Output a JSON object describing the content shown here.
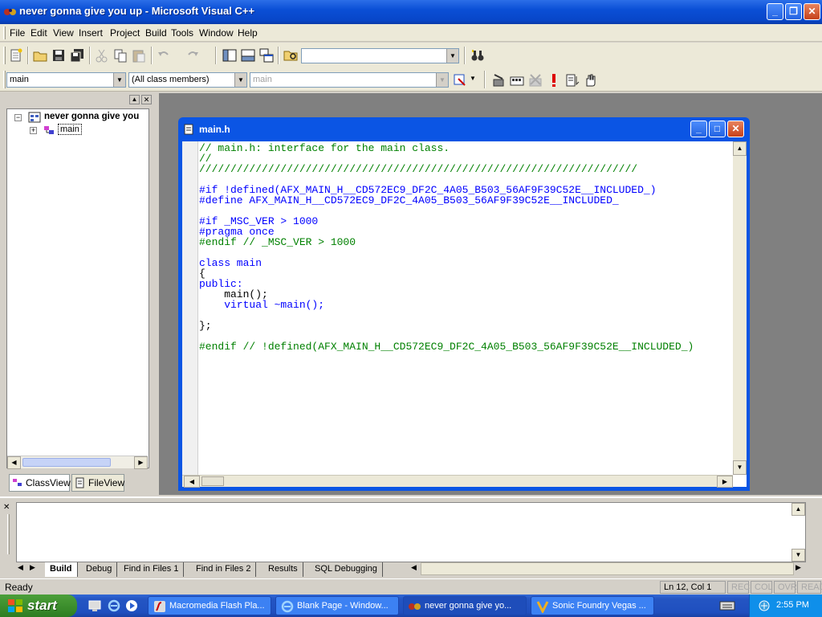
{
  "window": {
    "title": "never gonna give you up - Microsoft Visual C++"
  },
  "menu": [
    "File",
    "Edit",
    "View",
    "Insert",
    "Project",
    "Build",
    "Tools",
    "Window",
    "Help"
  ],
  "toolbar": {
    "find_combo_value": "",
    "class_combo": "main",
    "filter_combo": "(All class members)",
    "member_combo": "main"
  },
  "workspace": {
    "root_label": "never gonna give you",
    "child_label": "main",
    "tabs": [
      "ClassView",
      "FileView"
    ]
  },
  "editor": {
    "title": "main.h",
    "lines": [
      {
        "t": "// main.h: interface for the main class.",
        "c": "cm"
      },
      {
        "t": "//",
        "c": "cm"
      },
      {
        "t": "//////////////////////////////////////////////////////////////////////",
        "c": "cm"
      },
      {
        "t": "",
        "c": ""
      },
      {
        "t": "#if !defined(AFX_MAIN_H__CD572EC9_DF2C_4A05_B503_56AF9F39C52E__INCLUDED_)",
        "c": "kw"
      },
      {
        "t": "#define AFX_MAIN_H__CD572EC9_DF2C_4A05_B503_56AF9F39C52E__INCLUDED_",
        "c": "kw"
      },
      {
        "t": "",
        "c": ""
      },
      {
        "t": "#if _MSC_VER > 1000",
        "c": "kw"
      },
      {
        "t": "#pragma once",
        "c": "kw"
      },
      {
        "t": "#endif // _MSC_VER > 1000",
        "c": "cm"
      },
      {
        "t": "",
        "c": ""
      },
      {
        "t": "class main",
        "c": "kw"
      },
      {
        "t": "{",
        "c": ""
      },
      {
        "t": "public:",
        "c": "kw"
      },
      {
        "t": "    main();",
        "c": ""
      },
      {
        "t": "    virtual ~main();",
        "c": "kw"
      },
      {
        "t": "",
        "c": ""
      },
      {
        "t": "};",
        "c": ""
      },
      {
        "t": "",
        "c": ""
      },
      {
        "t": "#endif // !defined(AFX_MAIN_H__CD572EC9_DF2C_4A05_B503_56AF9F39C52E__INCLUDED_)",
        "c": "cm"
      }
    ]
  },
  "output": {
    "tabs": [
      "Build",
      "Debug",
      "Find in Files 1",
      "Find in Files 2",
      "Results",
      "SQL Debugging"
    ]
  },
  "status": {
    "text": "Ready",
    "position": "Ln 12, Col 1",
    "indicators": [
      "REC",
      "COL",
      "OVR",
      "READ"
    ]
  },
  "taskbar": {
    "start": "start",
    "tasks": [
      "Macromedia Flash Pla...",
      "Blank Page - Window...",
      "never gonna give yo...",
      "Sonic Foundry Vegas ..."
    ],
    "clock": "2:55 PM"
  },
  "colors": {
    "comment": "#008000",
    "keyword": "#0000ff",
    "titlebar": "#0a4fd6"
  }
}
